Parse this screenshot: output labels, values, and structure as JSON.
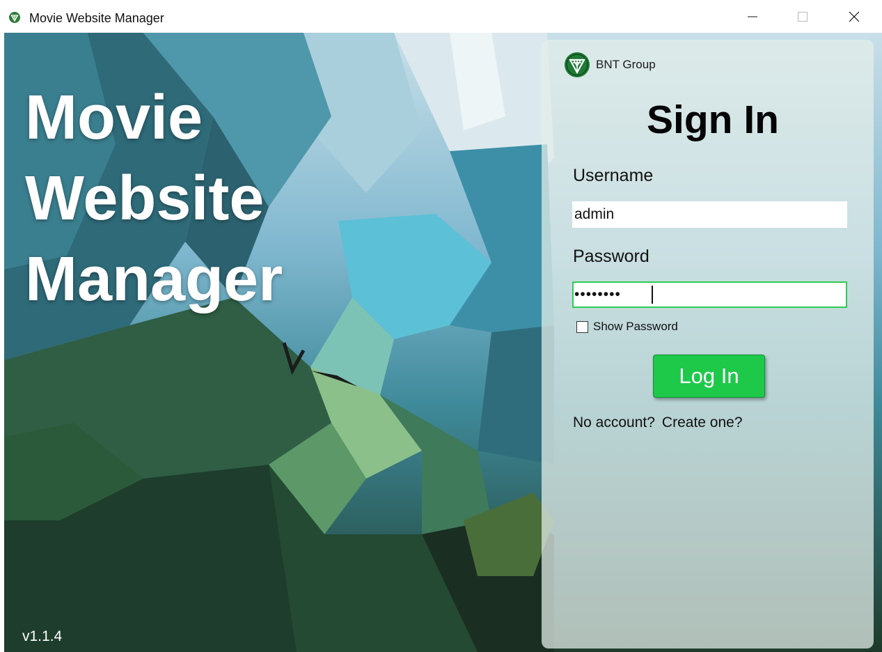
{
  "window": {
    "title": "Movie Website Manager",
    "icon": "bnt-logo-icon"
  },
  "hero": {
    "lines": [
      "Movie",
      "Website",
      "Manager"
    ]
  },
  "version": "v1.1.4",
  "panel": {
    "brand_name": "BNT Group",
    "title": "Sign In",
    "username_label": "Username",
    "username_value": "admin",
    "password_label": "Password",
    "password_masked": "••••••••",
    "show_password_label": "Show Password",
    "show_password_checked": false,
    "login_label": "Log In",
    "no_account_text": "No account?",
    "create_account_link": "Create one?"
  },
  "colors": {
    "accent": "#1ec94a",
    "focus_border": "#2ecc52",
    "brand_green": "#1a8a3a"
  }
}
